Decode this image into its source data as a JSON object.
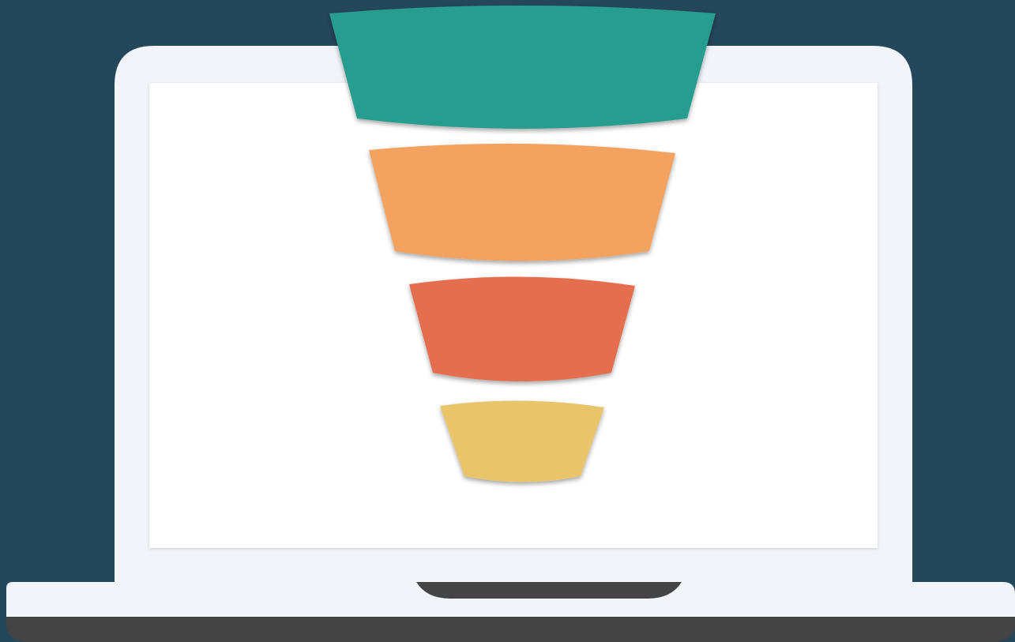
{
  "colors": {
    "background": "#25475a",
    "laptop_body": "#f1f4f9",
    "screen": "#ffffff",
    "base_bottom": "#444444",
    "trackpad_notch": "#444444"
  },
  "funnel": {
    "stages": [
      {
        "color": "#289d8f"
      },
      {
        "color": "#f3a261"
      },
      {
        "color": "#e56e4f"
      },
      {
        "color": "#e9c46a"
      }
    ]
  }
}
